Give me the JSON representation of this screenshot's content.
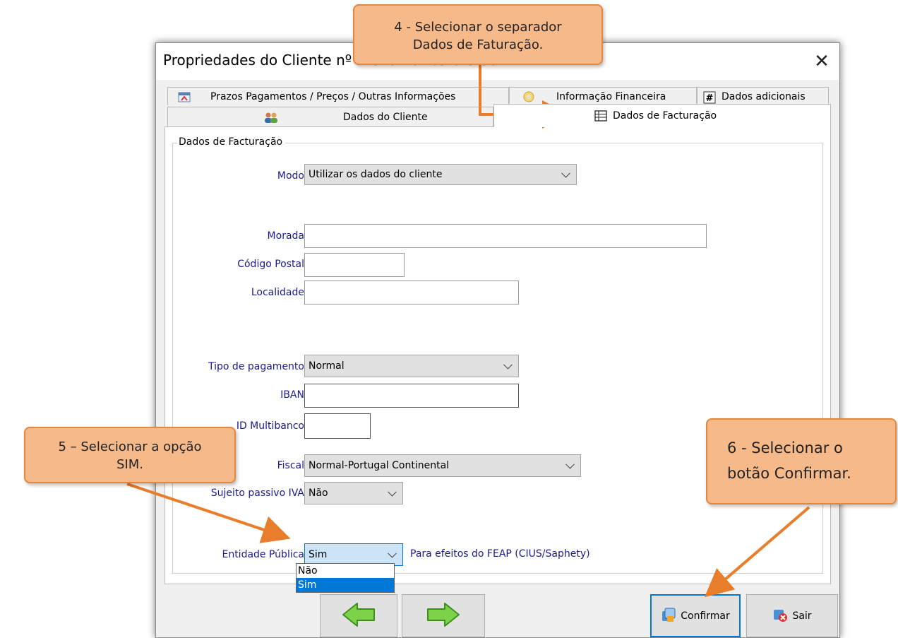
{
  "window": {
    "title": "Propriedades do Cliente nº 2 Cliente Teste CIUS",
    "close_icon": "close-icon"
  },
  "tabs": {
    "row1": [
      {
        "label": "Prazos Pagamentos / Preços / Outras Informações",
        "icon": "calendar-icon"
      },
      {
        "label": "Informação Financeira",
        "icon": "coins-icon"
      },
      {
        "label": "Dados adicionais",
        "icon": "hash-icon"
      }
    ],
    "row2": [
      {
        "label": "Dados do Cliente",
        "icon": "users-icon"
      },
      {
        "label": "Dados de Facturação",
        "icon": "table-icon",
        "active": true
      }
    ]
  },
  "group": {
    "title": "Dados de Facturação",
    "fields": {
      "modo": {
        "label": "Modo",
        "value": "Utilizar os dados do cliente"
      },
      "morada": {
        "label": "Morada",
        "value": ""
      },
      "codigo_postal": {
        "label": "Código Postal",
        "value": ""
      },
      "localidade": {
        "label": "Localidade",
        "value": ""
      },
      "tipo_pagamento": {
        "label": "Tipo de pagamento",
        "value": "Normal"
      },
      "iban": {
        "label": "IBAN",
        "value": ""
      },
      "id_multibanco": {
        "label": "ID Multibanco",
        "value": ""
      },
      "regime_fiscal": {
        "label": "Fiscal",
        "value": "Normal-Portugal Continental"
      },
      "sujeito_passivo": {
        "label": "Sujeito passivo IVA",
        "value": "Não"
      },
      "entidade_publica": {
        "label": "Entidade Pública",
        "value": "Sim",
        "note": "Para efeitos do FEAP (CIUS/Saphety)",
        "options": [
          "Não",
          "Sim"
        ],
        "selected": "Sim"
      }
    }
  },
  "buttons": {
    "back": {
      "icon": "arrow-left-icon"
    },
    "forward": {
      "icon": "arrow-right-icon"
    },
    "confirm": {
      "label": "Confirmar",
      "icon": "confirm-icon"
    },
    "exit": {
      "label": "Sair",
      "icon": "exit-icon"
    }
  },
  "callouts": {
    "step4": {
      "line1": "4 - Selecionar o separador",
      "line2": "Dados de Faturação."
    },
    "step5": {
      "line1": "5 – Selecionar a opção",
      "line2": "SIM."
    },
    "step6": {
      "line1": "6 - Selecionar o",
      "line2": "botão Confirmar."
    }
  },
  "colors": {
    "callout_fill": "#f6b98a",
    "callout_border": "#e4883f",
    "arrow": "#e87d2c",
    "label_blue": "#1a1a8c",
    "selection": "#0078d7"
  }
}
